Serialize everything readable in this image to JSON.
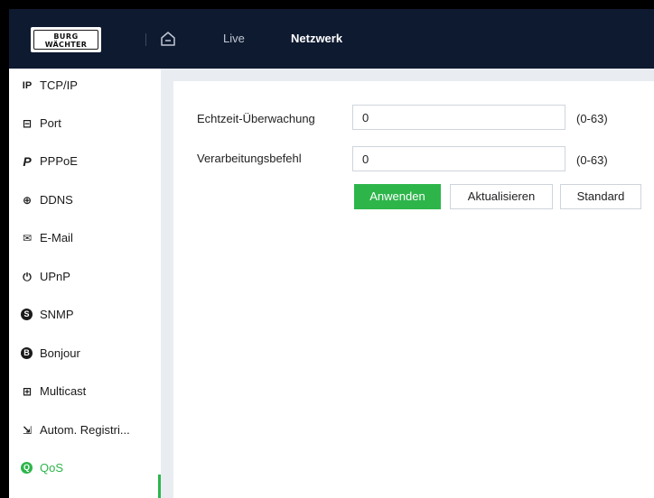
{
  "header": {
    "logo_line1": "BURG",
    "logo_line2": "WÄCHTER",
    "home_icon": "home-icon",
    "nav": [
      {
        "label": "Live"
      },
      {
        "label": "Netzwerk",
        "active": true
      }
    ]
  },
  "sidebar": {
    "items": [
      {
        "icon": "ip-icon",
        "icon_glyph": "IP",
        "label": "TCP/IP"
      },
      {
        "icon": "port-icon",
        "icon_glyph": "⊟",
        "label": "Port"
      },
      {
        "icon": "pppoe-icon",
        "icon_glyph": "P",
        "label": "PPPoE"
      },
      {
        "icon": "ddns-icon",
        "icon_glyph": "⊕",
        "label": "DDNS"
      },
      {
        "icon": "mail-icon",
        "icon_glyph": "✉",
        "label": "E-Mail"
      },
      {
        "icon": "upnp-icon",
        "icon_glyph": "⏻",
        "label": "UPnP"
      },
      {
        "icon": "snmp-icon",
        "icon_glyph": "S",
        "label": "SNMP"
      },
      {
        "icon": "bonjour-icon",
        "icon_glyph": "B",
        "label": "Bonjour"
      },
      {
        "icon": "multicast-icon",
        "icon_glyph": "⊞",
        "label": "Multicast"
      },
      {
        "icon": "register-icon",
        "icon_glyph": "⇲",
        "label": "Autom. Registri..."
      },
      {
        "icon": "qos-icon",
        "icon_glyph": "Q",
        "label": "QoS",
        "active": true
      }
    ],
    "active_color": "#2db54a"
  },
  "form": {
    "rows": [
      {
        "label": "Echtzeit-Überwachung",
        "value": "0",
        "range": "(0-63)"
      },
      {
        "label": "Verarbeitungsbefehl",
        "value": "0",
        "range": "(0-63)"
      }
    ],
    "buttons": {
      "apply": "Anwenden",
      "refresh": "Aktualisieren",
      "default": "Standard"
    }
  },
  "colors": {
    "topbar": "#0e1a30",
    "accent": "#2db54a",
    "page_bg": "#e9ecf1"
  }
}
